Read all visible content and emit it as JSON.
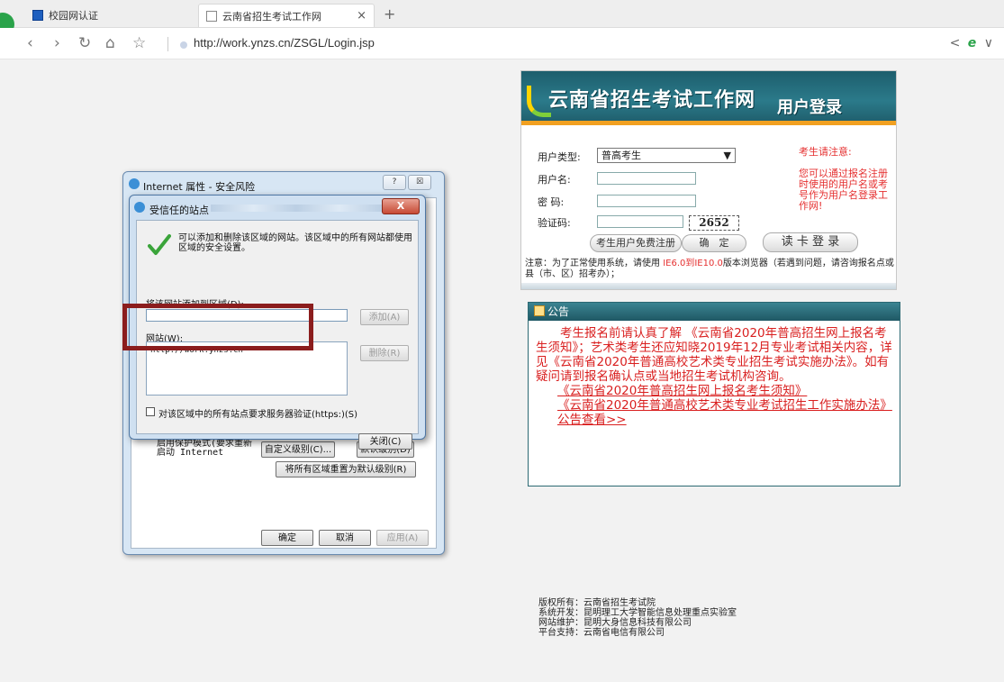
{
  "browser": {
    "tabs": [
      {
        "label": "校园网认证"
      },
      {
        "label": "云南省招生考试工作网"
      }
    ],
    "tab_close": "×",
    "new_tab": "+",
    "url": "http://work.ynzs.cn/ZSGL/Login.jsp",
    "nav": {
      "back": "‹",
      "forward": "›",
      "refresh": "↻",
      "home": "⌂",
      "star": "☆"
    },
    "right": {
      "share": "<",
      "engine": "e",
      "menu": "∨"
    }
  },
  "login": {
    "banner_title": "云南省招生考试工作网",
    "banner_sub": "用户登录",
    "user_type_label": "用户类型:",
    "user_type_value": "普高考生",
    "username_label": "用户名:",
    "password_label": "密  码:",
    "captcha_label": "验证码:",
    "captcha_value": "2652",
    "register_btn": "考生用户免费注册",
    "confirm_btn": "确　定",
    "card_btn": "读 卡 登 录",
    "notice_title": "考生请注意:",
    "notice_text": "您可以通过报名注册时使用的用户名或考号作为用户名登录工作网!",
    "note_prefix": "注意：为了正常使用系统，请使用 ",
    "note_red": "IE6.0到IE10.0",
    "note_suffix": "版本浏览器（若遇到问题，请咨询报名点或县（市、区）招考办）；"
  },
  "announcement": {
    "title": "公告",
    "body": "考生报名前请认真了解 《云南省2020年普高招生网上报名考生须知》；艺术类考生还应知晓2019年12月专业考试相关内容，详见《云南省2020年普通高校艺术类专业招生考试实施办法》。如有疑问请到报名确认点或当地招生考试机构咨询。",
    "links": [
      "《云南省2020年普高招生网上报名考生须知》",
      "《云南省2020年普通高校艺术类专业考试招生工作实施办法》",
      "公告查看>>"
    ]
  },
  "footer": {
    "lines": [
      "版权所有：云南省招生考试院",
      "系统开发：昆明理工大学智能信息处理重点实验室",
      "网站维护：昆明大身信息科技有限公司",
      "平台支持：云南省电信有限公司"
    ]
  },
  "internet_props": {
    "title": "Internet 属性 - 安全风险",
    "help": "?",
    "close": "☒",
    "protected_mode": "启用保护模式(要求重新启动 Internet",
    "custom_level": "自定义级别(C)...",
    "default_level": "默认级别(D)",
    "reset_all": "将所有区域重置为默认级别(R)",
    "ok": "确定",
    "cancel": "取消",
    "apply": "应用(A)"
  },
  "trusted_sites": {
    "title": "受信任的站点",
    "close": "X",
    "desc": "可以添加和删除该区域的网站。该区域中的所有网站都使用区域的安全设置。",
    "add_label": "将该网站添加到区域(D):",
    "add_btn": "添加(A)",
    "sites_label": "网站(W):",
    "sites": [
      "http://work.ynzs.cn"
    ],
    "remove_btn": "删除(R)",
    "https_check": "对该区域中的所有站点要求服务器验证(https:)(S)",
    "close_btn": "关闭(C)"
  },
  "colors": {
    "highlight": "#8b1d1d",
    "announce_red": "#d91f1f",
    "banner": "#1d5e6d"
  }
}
